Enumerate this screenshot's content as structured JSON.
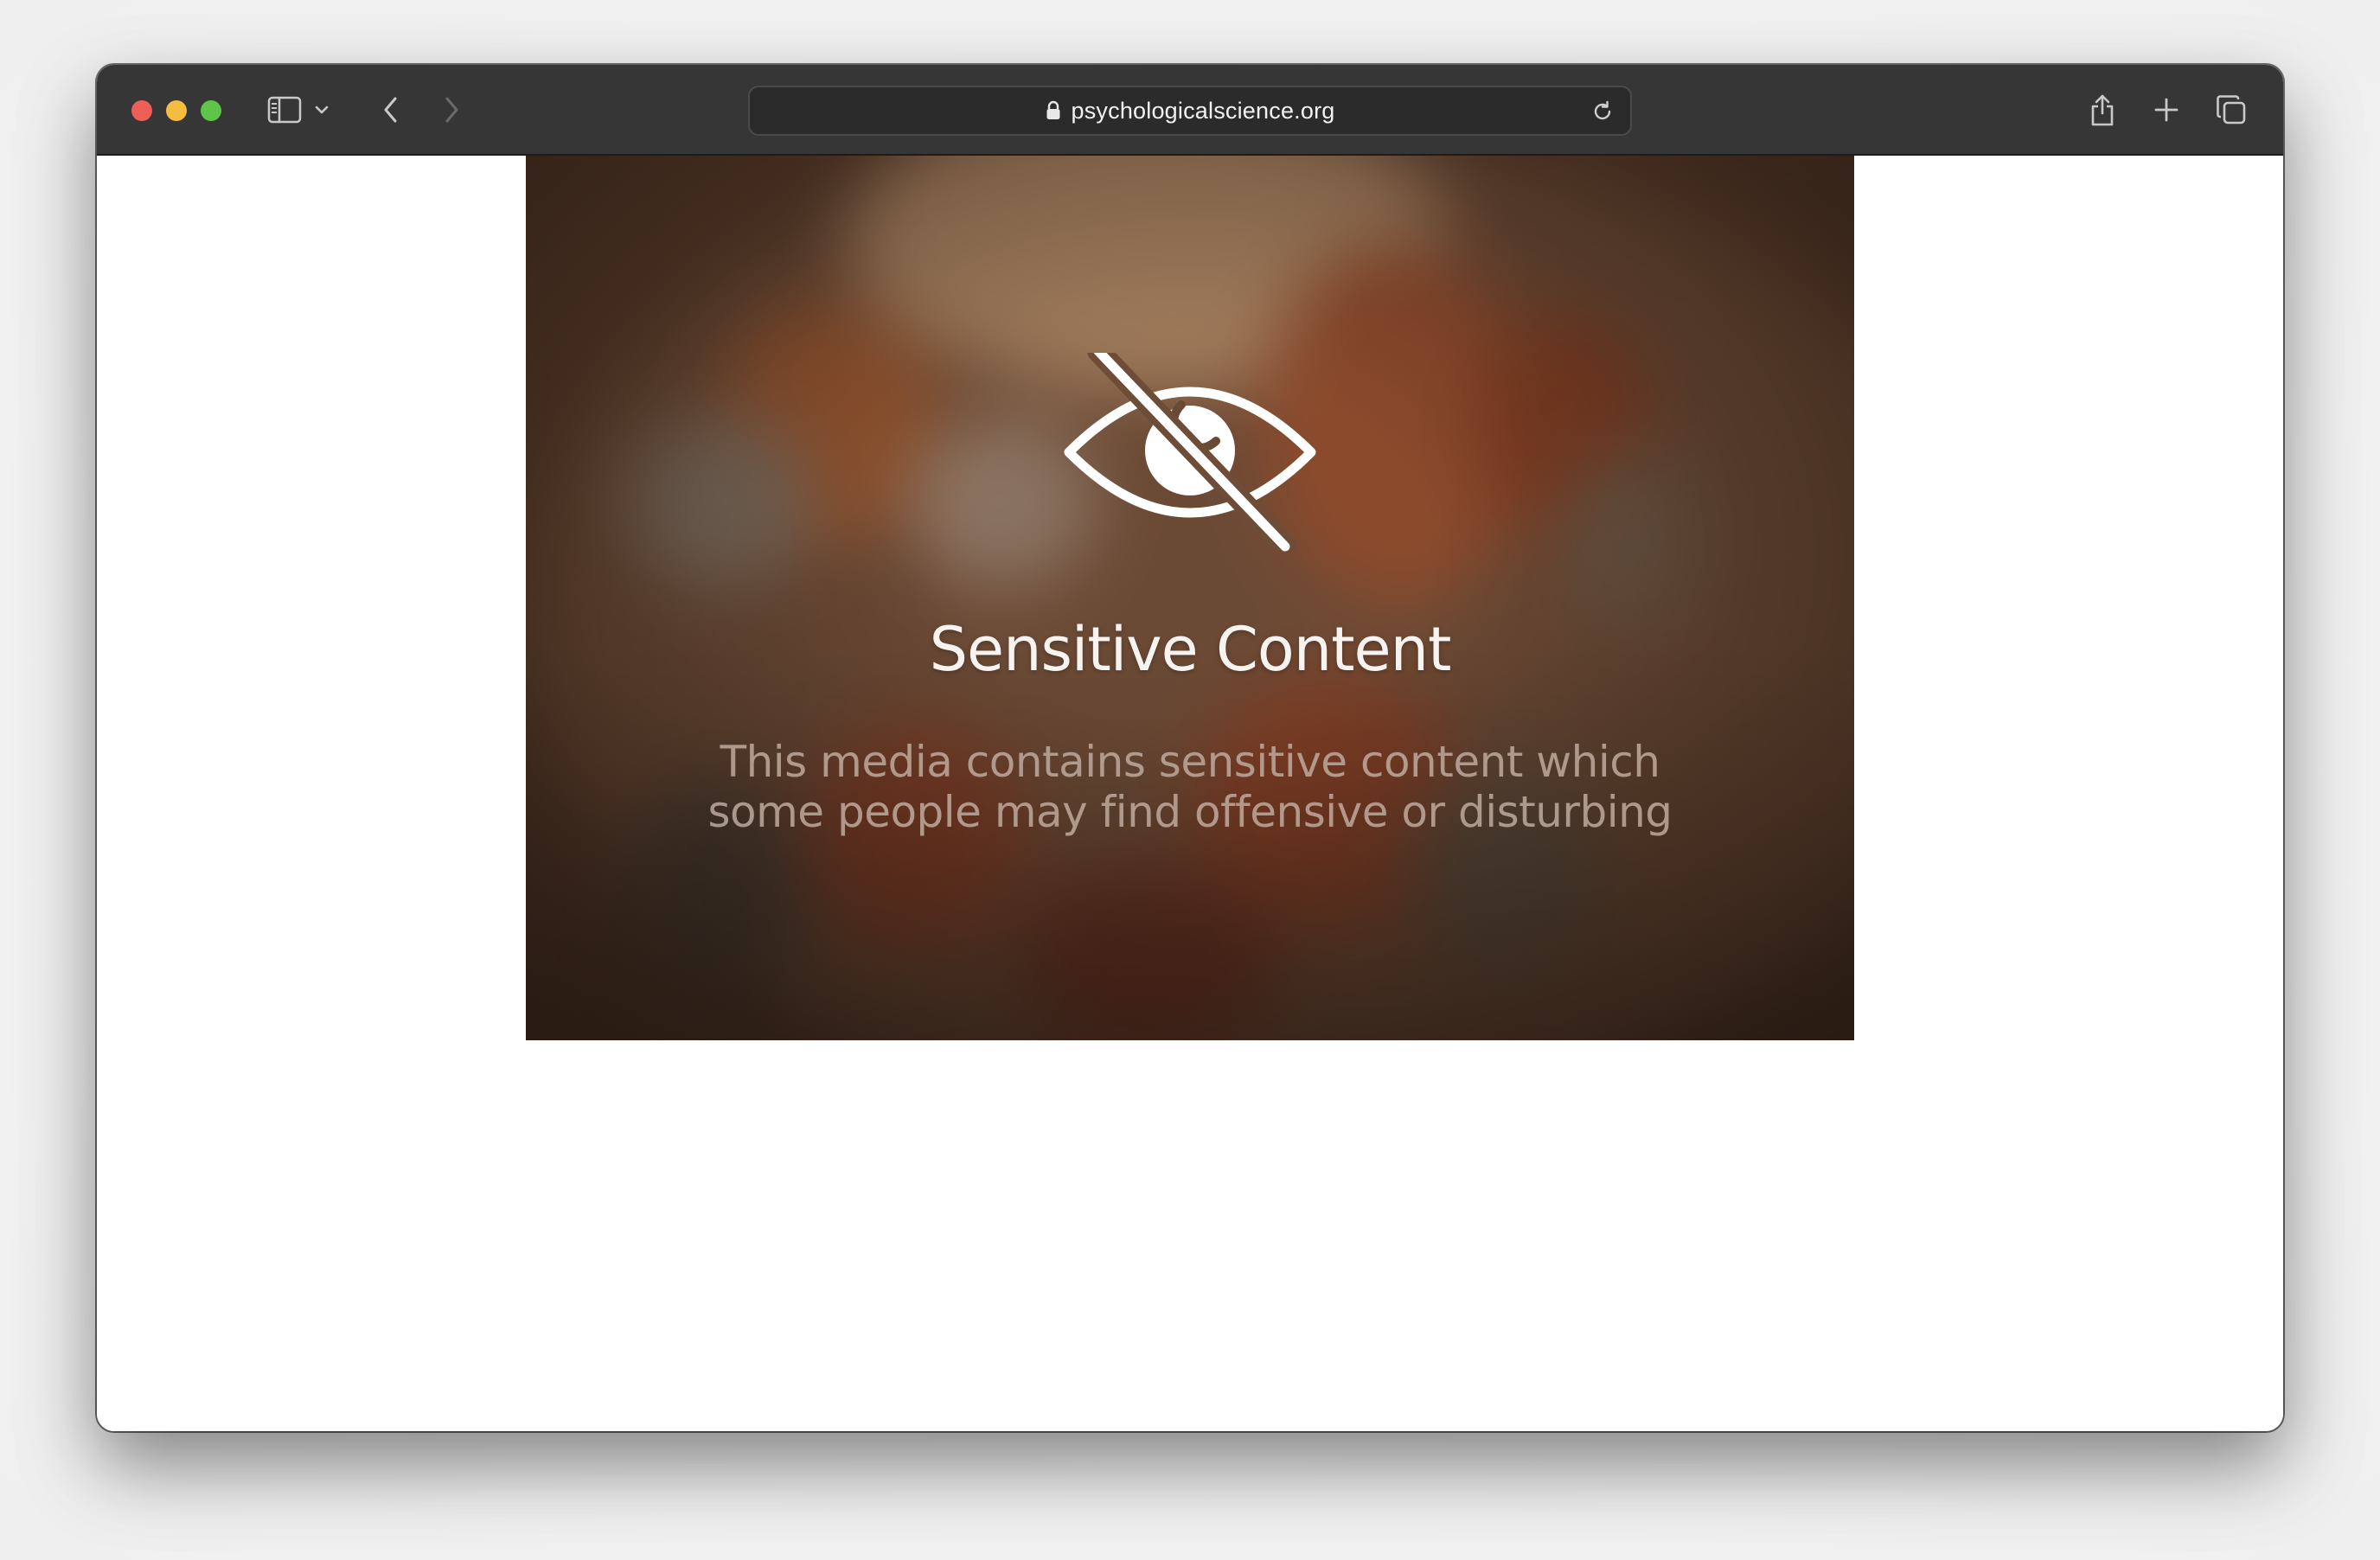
{
  "browser": {
    "url_text": "psychologicalscience.org",
    "colors": {
      "toolbar": "#363636",
      "close": "#ee5f57",
      "minimize": "#f4bd3f",
      "maximize": "#5ec549"
    },
    "icons": [
      "sidebar-icon",
      "chevron-down-icon",
      "back-icon",
      "forward-icon",
      "lock-icon",
      "reload-icon",
      "share-icon",
      "new-tab-icon",
      "tabs-overview-icon"
    ]
  },
  "media": {
    "title": "Sensitive Content",
    "description_line1": "This media contains sensitive content which",
    "description_line2": "some people may find offensive or disturbing",
    "icon": "eye-slash-icon"
  }
}
